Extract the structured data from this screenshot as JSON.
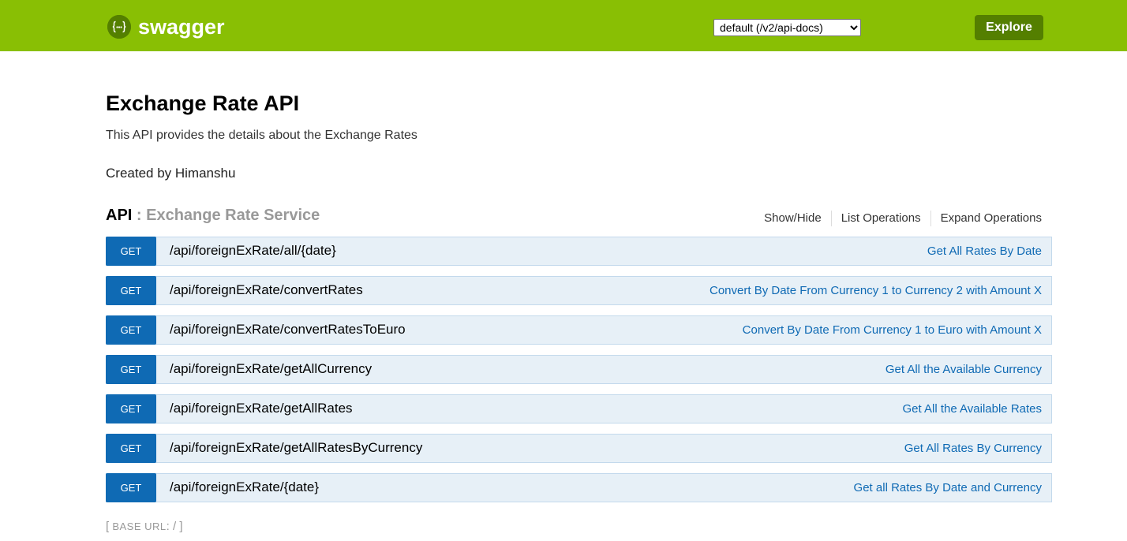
{
  "header": {
    "logo_icon_glyph": "{‧‧}",
    "logo_text": "swagger",
    "spec_select": {
      "selected": "default (/v2/api-docs)",
      "options": [
        "default (/v2/api-docs)"
      ]
    },
    "explore_label": "Explore",
    "bg_color": "#89bf04",
    "button_color": "#547f00"
  },
  "info": {
    "title": "Exchange Rate API",
    "description": "This API provides the details about the Exchange Rates",
    "created_by": "Created by Himanshu"
  },
  "resource": {
    "prefix": "API",
    "separator": " : ",
    "name": "Exchange Rate Service",
    "options": [
      "Show/Hide",
      "List Operations",
      "Expand Operations"
    ]
  },
  "operations": [
    {
      "method": "GET",
      "path": "/api/foreignExRate/all/{date}",
      "summary": "Get All Rates By Date"
    },
    {
      "method": "GET",
      "path": "/api/foreignExRate/convertRates",
      "summary": "Convert By Date From Currency 1 to Currency 2 with Amount X"
    },
    {
      "method": "GET",
      "path": "/api/foreignExRate/convertRatesToEuro",
      "summary": "Convert By Date From Currency 1 to Euro with Amount X"
    },
    {
      "method": "GET",
      "path": "/api/foreignExRate/getAllCurrency",
      "summary": "Get All the Available Currency"
    },
    {
      "method": "GET",
      "path": "/api/foreignExRate/getAllRates",
      "summary": "Get All the Available Rates"
    },
    {
      "method": "GET",
      "path": "/api/foreignExRate/getAllRatesByCurrency",
      "summary": "Get All Rates By Currency"
    },
    {
      "method": "GET",
      "path": "/api/foreignExRate/{date}",
      "summary": "Get all Rates By Date and Currency"
    }
  ],
  "footer": {
    "open_bracket": "[ ",
    "base_url_label": "BASE URL",
    "base_url_value": ": / ",
    "close_bracket": "]"
  },
  "colors": {
    "get_method": "#0f6ab4",
    "get_row_bg": "#e7f0f7",
    "get_row_border": "#c3d9ec"
  }
}
